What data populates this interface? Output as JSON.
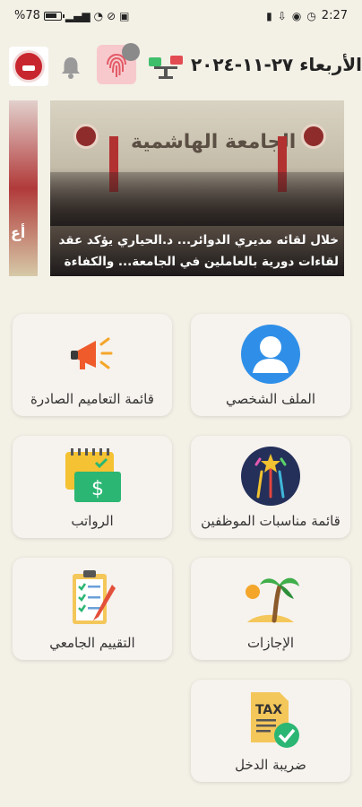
{
  "status_bar": {
    "battery": "%78",
    "time": "2:27"
  },
  "header": {
    "date": "الأربعاء ٢٧-١١-٢٠٢٤"
  },
  "carousel": {
    "banner_text": "الجامعة الهاشمية",
    "prev_slide_text": "أع",
    "caption": "خلال لقائه مديري الدوائر... د.الحياري يؤكد عقد لقاءات دورية بالعاملين في الجامعة... والكفاءة"
  },
  "menu": {
    "items": [
      {
        "label": "الملف الشخصي",
        "icon": "profile-icon"
      },
      {
        "label": "قائمة التعاميم الصادرة",
        "icon": "megaphone-icon"
      },
      {
        "label": "قائمة مناسبات الموظفين",
        "icon": "fireworks-icon"
      },
      {
        "label": "الرواتب",
        "icon": "salary-calendar-icon"
      },
      {
        "label": "الإجازات",
        "icon": "palm-tree-icon"
      },
      {
        "label": "التقييم الجامعي",
        "icon": "checklist-icon"
      },
      {
        "label": "ضريبة الدخل",
        "icon": "tax-icon"
      }
    ]
  },
  "colors": {
    "background": "#f3f0e6",
    "card": "#f6f2ee",
    "brand_red": "#c8262f"
  }
}
